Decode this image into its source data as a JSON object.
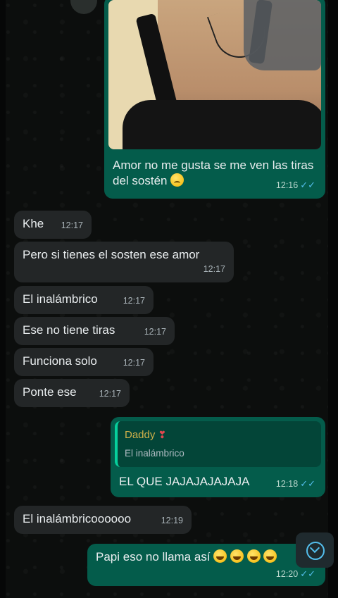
{
  "messages": [
    {
      "text": "Amor no me gusta se me ven las tiras del sostén",
      "time": "12:16",
      "emoji": "sad-face-emoji"
    },
    {
      "text": "Khe",
      "time": "12:17"
    },
    {
      "text": "Pero si tienes el sosten ese amor",
      "time": "12:17"
    },
    {
      "text": "El inalámbrico",
      "time": "12:17"
    },
    {
      "text": "Ese no tiene tiras",
      "time": "12:17"
    },
    {
      "text": "Funciona solo",
      "time": "12:17"
    },
    {
      "text": "Ponte ese",
      "time": "12:17"
    },
    {
      "quote_author": "Daddy",
      "quote_text": "El inalámbrico",
      "text": "EL QUE JAJAJAJAJAJA",
      "time": "12:18"
    },
    {
      "text": "El inalámbricoooooo",
      "time": "12:19"
    },
    {
      "text": "Papi eso no llama así",
      "time": "12:20",
      "emoji": "laughing-emoji"
    }
  ],
  "colors": {
    "incoming": "#232627",
    "outgoing": "#045c4b",
    "read_ticks": "#53bdeb"
  }
}
